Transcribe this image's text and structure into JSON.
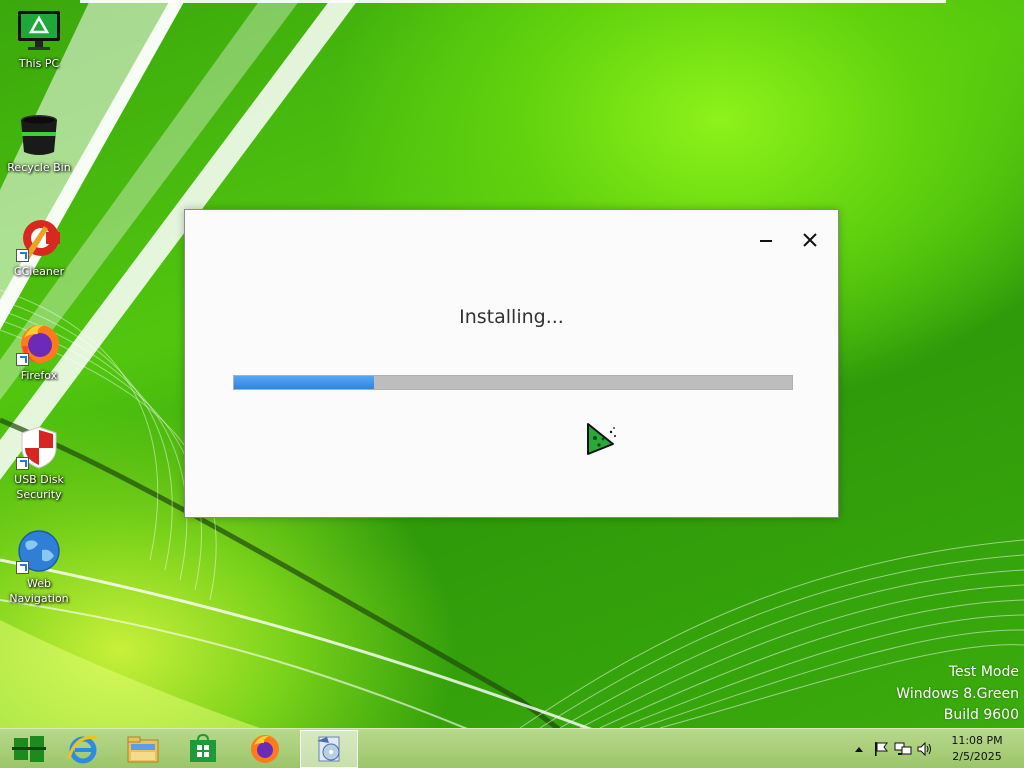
{
  "desktop": {
    "icons": [
      {
        "label": "This PC"
      },
      {
        "label": "Recycle Bin"
      },
      {
        "label": "CCleaner"
      },
      {
        "label": "Firefox"
      },
      {
        "label": "USB Disk Security"
      },
      {
        "label": "Web Navigation"
      }
    ],
    "watermark": {
      "line1": "Test Mode",
      "line2": "Windows 8.Green",
      "line3": "Build 9600"
    }
  },
  "installer": {
    "status_text": "Installing...",
    "progress_fraction": 0.25,
    "progress_color": "#2f84e0"
  },
  "taskbar": {
    "items": [
      {
        "icon": "start-icon"
      },
      {
        "icon": "internet-explorer-icon"
      },
      {
        "icon": "file-explorer-icon"
      },
      {
        "icon": "store-icon"
      },
      {
        "icon": "firefox-icon"
      },
      {
        "icon": "installer-app-icon",
        "active": true
      }
    ],
    "tray_icons": [
      "show-hidden-icons-icon",
      "action-center-flag-icon",
      "network-icon",
      "volume-icon"
    ],
    "clock": {
      "time": "11:08 PM",
      "date": "2/5/2025"
    }
  },
  "colors": {
    "wallpaper_green": "#3fb30a",
    "taskbar": "#b8d98c",
    "dialog_bg": "#fbfbfb"
  }
}
